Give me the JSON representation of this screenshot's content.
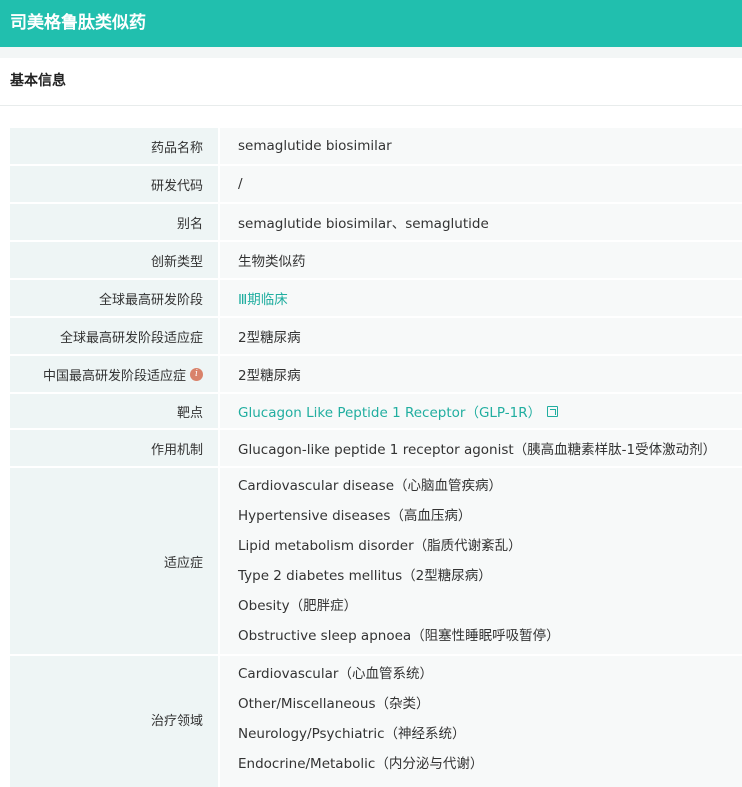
{
  "header": {
    "title": "司美格鲁肽类似药"
  },
  "section": {
    "title": "基本信息"
  },
  "rows": {
    "drug_name": {
      "label": "药品名称",
      "value": "semaglutide biosimilar"
    },
    "dev_code": {
      "label": "研发代码",
      "value": "/"
    },
    "alias": {
      "label": "别名",
      "value": "semaglutide biosimilar、semaglutide"
    },
    "innovation": {
      "label": "创新类型",
      "value": "生物类似药"
    },
    "global_phase": {
      "label": "全球最高研发阶段",
      "value": "Ⅲ期临床"
    },
    "global_indication": {
      "label": "全球最高研发阶段适应症",
      "value": "2型糖尿病"
    },
    "china_indication": {
      "label": "中国最高研发阶段适应症",
      "value": "2型糖尿病"
    },
    "target": {
      "label": "靶点",
      "value": "Glucagon Like Peptide 1 Receptor（GLP-1R）"
    },
    "mechanism": {
      "label": "作用机制",
      "value": "Glucagon-like peptide 1 receptor agonist（胰高血糖素样肽-1受体激动剂）"
    },
    "indications": {
      "label": "适应症",
      "items": [
        "Cardiovascular disease（心脑血管疾病）",
        "Hypertensive diseases（高血压病）",
        "Lipid metabolism disorder（脂质代谢紊乱）",
        "Type 2 diabetes mellitus（2型糖尿病）",
        "Obesity（肥胖症）",
        "Obstructive sleep apnoea（阻塞性睡眠呼吸暂停）"
      ]
    },
    "therapeutic_areas": {
      "label": "治疗领域",
      "items": [
        "Cardiovascular（心血管系统）",
        "Other/Miscellaneous（杂类）",
        "Neurology/Psychiatric（神经系统）",
        "Endocrine/Metabolic（内分泌与代谢）"
      ]
    }
  },
  "icons": {
    "info": "info-icon",
    "external_link": "external-link-icon"
  },
  "colors": {
    "header_bg": "#21bfae",
    "link": "#21aea0",
    "info_icon": "#d9826a"
  }
}
